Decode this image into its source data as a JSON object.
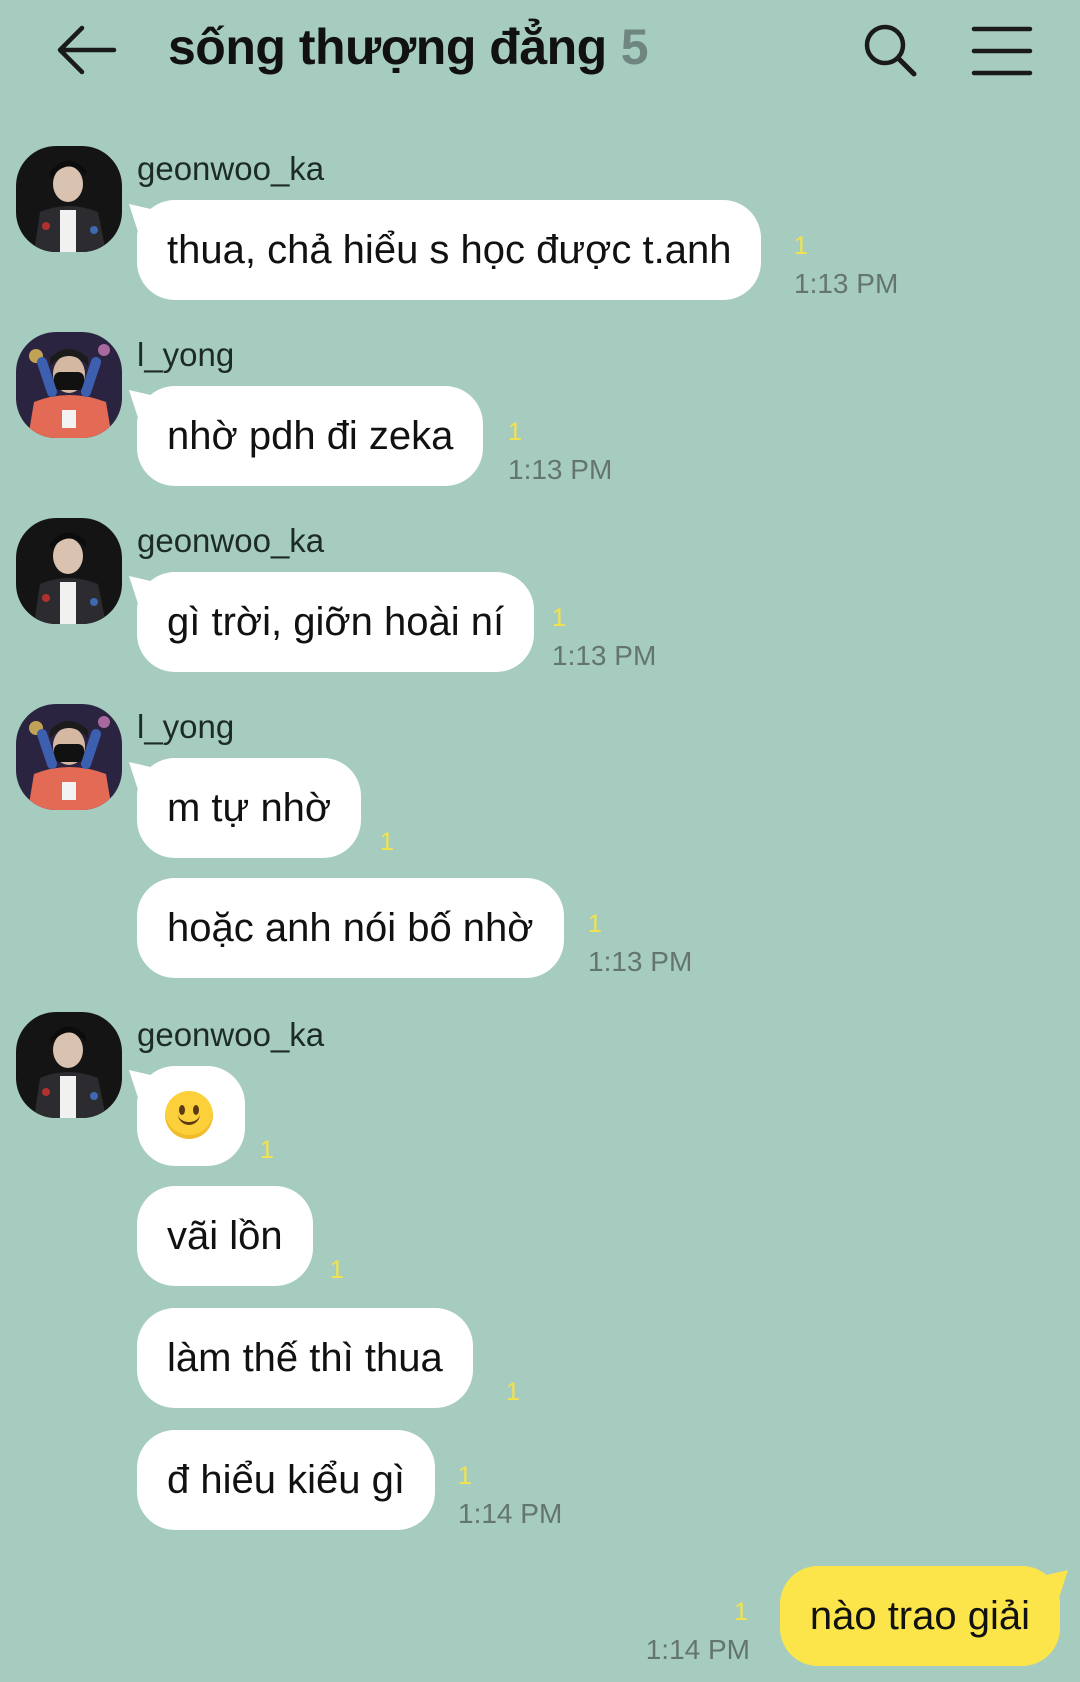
{
  "header": {
    "title": "sống thượng đẳng",
    "member_count": "5",
    "back_icon": "arrow-left-icon",
    "search_icon": "search-icon",
    "menu_icon": "hamburger-menu-icon"
  },
  "colors": {
    "background": "#a6ccbf",
    "bubble_incoming": "#ffffff",
    "bubble_outgoing": "#fbe54a",
    "unread_count": "#f4e24c",
    "timestamp": "#647570"
  },
  "messages": [
    {
      "sender": "geonwoo_ka",
      "text": "thua, chả hiểu s học được t.anh",
      "unread": "1",
      "time": "1:13 PM"
    },
    {
      "sender": "l_yong",
      "text": "nhờ pdh đi zeka",
      "unread": "1",
      "time": "1:13 PM"
    },
    {
      "sender": "geonwoo_ka",
      "text": "gì trời, giỡn hoài ní",
      "unread": "1",
      "time": "1:13 PM"
    },
    {
      "sender": "l_yong",
      "text": "m tự nhờ",
      "unread": "1"
    },
    {
      "text": "hoặc anh nói bố nhờ",
      "unread": "1",
      "time": "1:13 PM"
    },
    {
      "sender": "geonwoo_ka",
      "emoji": "slightly-smiling-face-emoji",
      "unread": "1"
    },
    {
      "text": "vãi lồn",
      "unread": "1"
    },
    {
      "text": "làm thế thì thua",
      "unread": "1"
    },
    {
      "text": "đ hiểu kiểu gì",
      "unread": "1",
      "time": "1:14 PM"
    },
    {
      "text": "nào trao giải",
      "unread": "1",
      "time": "1:14 PM",
      "outgoing": true
    }
  ]
}
